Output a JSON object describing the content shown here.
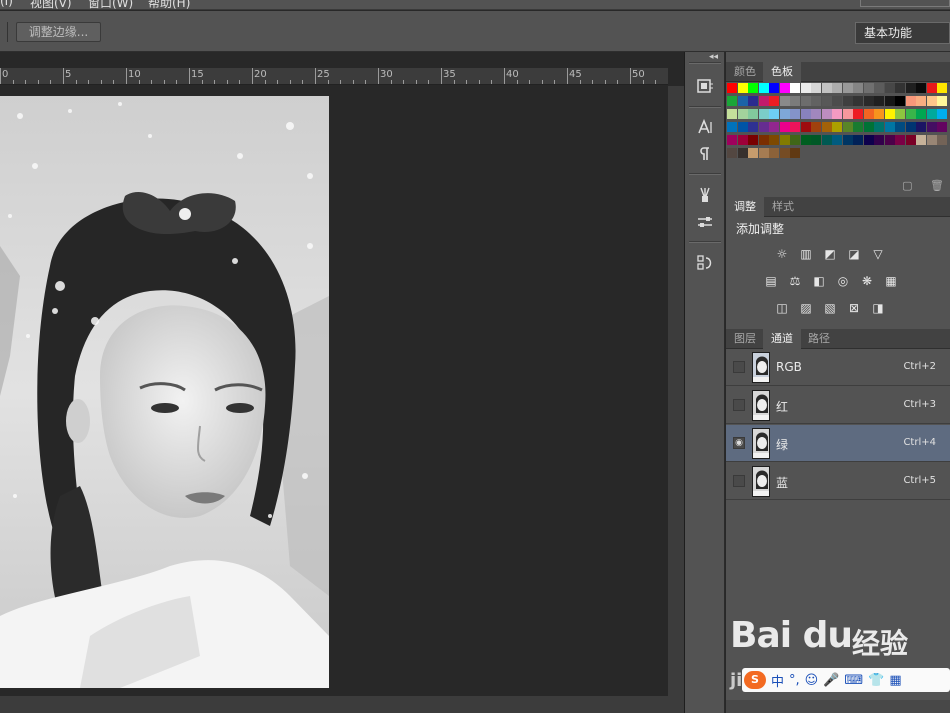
{
  "menu": {
    "items": [
      "(I)",
      "视图(V)",
      "窗口(W)",
      "帮助(H)"
    ]
  },
  "options_bar": {
    "refine_edge_label": "调整边缘...",
    "workspace_label": "基本功能"
  },
  "ruler": {
    "labels": [
      "0",
      "5",
      "10",
      "15",
      "20",
      "25",
      "30",
      "35",
      "40",
      "45",
      "50"
    ]
  },
  "toolstrip": {
    "collapse_glyph": "◂◂",
    "tools": [
      "history-icon",
      "character-icon",
      "paragraph-icon",
      "brush-preset-icon",
      "tool-preset-icon",
      "clone-source-icon"
    ]
  },
  "swatches_panel": {
    "tabs": [
      "颜色",
      "色板"
    ],
    "active_tab": "色板",
    "colors": [
      [
        "#ff0000",
        "#ffff00",
        "#00ff00",
        "#00ffff",
        "#0000ff",
        "#ff00ff",
        "#ffffff",
        "#ebebeb",
        "#d6d6d6",
        "#c2c2c2",
        "#adadad",
        "#999999",
        "#858585",
        "#707070",
        "#5c5c5c",
        "#474747",
        "#333333",
        "#1f1f1f",
        "#0a0a0a",
        "#e8191a",
        "#ffe600"
      ],
      [
        "#1aa638",
        "#1c63a8",
        "#2b2b8e",
        "#c21a6b",
        "#ed1c24",
        "#8a8a8a",
        "#7b7b7b",
        "#6d6d6d",
        "#626262",
        "#585858",
        "#4c4c4c",
        "#3f3f3f",
        "#343434",
        "#2a2a2a",
        "#202020",
        "#161616",
        "#000000",
        "#f7977a",
        "#f9ad81",
        "#fdc68a",
        "#fff79a"
      ],
      [
        "#c4df9b",
        "#a3d39c",
        "#82ca9d",
        "#7bcdc8",
        "#6ecff6",
        "#7ea7d8",
        "#8493ca",
        "#8882be",
        "#a187be",
        "#bc8dbf",
        "#f49ac2",
        "#f6989d",
        "#ed1c24",
        "#f26522",
        "#f7941d",
        "#fff200",
        "#8dc63f",
        "#39b54a",
        "#00a651",
        "#00a99d",
        "#00aeef"
      ],
      [
        "#0072bc",
        "#0054a6",
        "#2e3192",
        "#662d91",
        "#92278f",
        "#ec008c",
        "#ed145b",
        "#9e0b0f",
        "#a0410d",
        "#a36209",
        "#aba000",
        "#598527",
        "#197b30",
        "#007236",
        "#00746b",
        "#0076a3",
        "#004b80",
        "#003471",
        "#1b1464",
        "#440e62",
        "#630460"
      ],
      [
        "#9e005d",
        "#9e0039",
        "#790000",
        "#7b2e00",
        "#7d4900",
        "#827b00",
        "#406618",
        "#005e20",
        "#005826",
        "#005952",
        "#005b7f",
        "#003663",
        "#002157",
        "#0d004c",
        "#32004b",
        "#4b0049",
        "#7b0046",
        "#7a0026",
        "#c7b299",
        "#998675",
        "#736357"
      ],
      [
        "#534741",
        "#37302d",
        "#c69c6d",
        "#a67c52",
        "#8c6239",
        "#754c24",
        "#603913"
      ]
    ]
  },
  "adjustments_panel": {
    "tabs": [
      "调整",
      "样式"
    ],
    "active_tab": "调整",
    "title": "添加调整",
    "row1": [
      "brightness-icon",
      "levels-icon",
      "curves-icon",
      "exposure-icon",
      "vibrance-icon"
    ],
    "row2": [
      "hue-saturation-icon",
      "color-balance-icon",
      "black-white-icon",
      "photo-filter-icon",
      "channel-mixer-icon",
      "color-lookup-icon"
    ],
    "row3": [
      "invert-icon",
      "posterize-icon",
      "threshold-icon",
      "selective-color-icon",
      "gradient-map-icon"
    ]
  },
  "layers_panel": {
    "tabs": [
      "图层",
      "通道",
      "路径"
    ],
    "active_tab": "通道",
    "channels": [
      {
        "name": "RGB",
        "shortcut": "Ctrl+2",
        "visible": false,
        "selected": false
      },
      {
        "name": "红",
        "shortcut": "Ctrl+3",
        "visible": false,
        "selected": false
      },
      {
        "name": "绿",
        "shortcut": "Ctrl+4",
        "visible": true,
        "selected": true
      },
      {
        "name": "蓝",
        "shortcut": "Ctrl+5",
        "visible": false,
        "selected": false
      }
    ]
  },
  "watermark": {
    "logo": "Bai du",
    "suffix": "经验",
    "sub": "jingyan"
  },
  "ime": {
    "lang": "中",
    "punct": "°,",
    "logo": "S"
  },
  "colors": {
    "panel_bg": "#535353",
    "canvas_bg": "#282828",
    "selection": "#5e6b80"
  }
}
